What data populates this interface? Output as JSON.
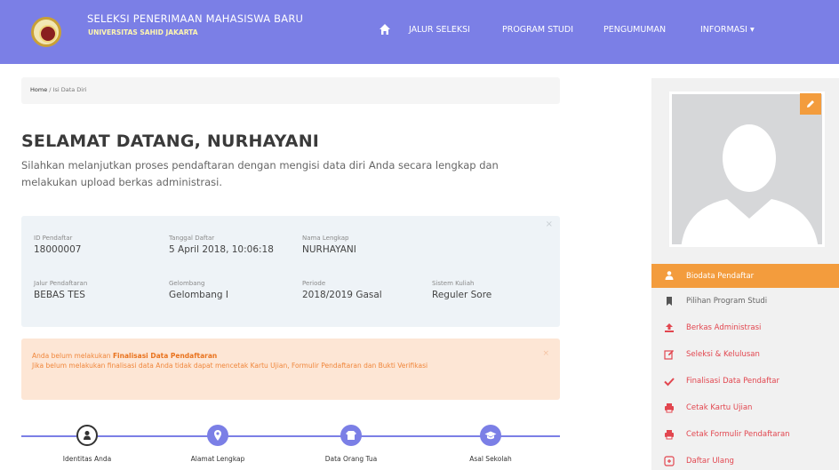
{
  "navbar": {
    "brand_title": "SELEKSI PENERIMAAN MAHASISWA BARU",
    "brand_subtitle": "UNIVERSITAS SAHID JAKARTA",
    "links": [
      "JALUR SELEKSI",
      "PROGRAM STUDI",
      "PENGUMUMAN",
      "INFORMASI ▾"
    ]
  },
  "breadcrumb": {
    "home": "Home",
    "sep": " / ",
    "current": "Isi Data Diri"
  },
  "welcome": "SELAMAT DATANG, NURHAYANI",
  "intro": "Silahkan melanjutkan proses pendaftaran dengan mengisi data diri Anda secara lengkap dan melakukan upload berkas administrasi.",
  "info": {
    "close": "×",
    "row1": [
      {
        "label": "ID Pendaftar",
        "value": "18000007"
      },
      {
        "label": "Tanggal Daftar",
        "value": "5 April 2018, 10:06:18"
      },
      {
        "label": "Nama Lengkap",
        "value": "NURHAYANI"
      }
    ],
    "row2": [
      {
        "label": "Jalur Pendaftaran",
        "value": "BEBAS TES"
      },
      {
        "label": "Gelombang",
        "value": "Gelombang I"
      },
      {
        "label": "Periode",
        "value": "2018/2019 Gasal"
      },
      {
        "label": "Sistem Kuliah",
        "value": "Reguler Sore"
      }
    ]
  },
  "alert": {
    "close": "×",
    "prefix": "Anda belum melakukan ",
    "bold": "Finalisasi Data Pendaftaran",
    "detail": "Jika belum melakukan finalisasi data Anda tidak dapat mencetak Kartu Ujian, Formulir Pendaftaran dan Bukti Verifikasi"
  },
  "steps": [
    "Identitas Anda",
    "Alamat Lengkap",
    "Data Orang Tua",
    "Asal Sekolah"
  ],
  "sidebar": {
    "items": [
      {
        "label": "Biodata Pendaftar",
        "icon": "user-icon",
        "active": true
      },
      {
        "label": "Pilihan Program Studi",
        "icon": "bookmark-icon"
      },
      {
        "label": "Berkas Administrasi",
        "icon": "upload-icon"
      },
      {
        "label": "Seleksi & Kelulusan",
        "icon": "edit-icon"
      },
      {
        "label": "Finalisasi Data Pendaftar",
        "icon": "check-icon"
      },
      {
        "label": "Cetak Kartu Ujian",
        "icon": "print-icon"
      },
      {
        "label": "Cetak Formulir Pendaftaran",
        "icon": "print-icon"
      },
      {
        "label": "Daftar Ulang",
        "icon": "register-icon"
      }
    ]
  },
  "colors": {
    "primary": "#7b7fe6",
    "accent": "#f39c3d",
    "danger": "#e2464f",
    "alert_bg": "#fde6d5",
    "info_bg": "#eef3f7"
  }
}
